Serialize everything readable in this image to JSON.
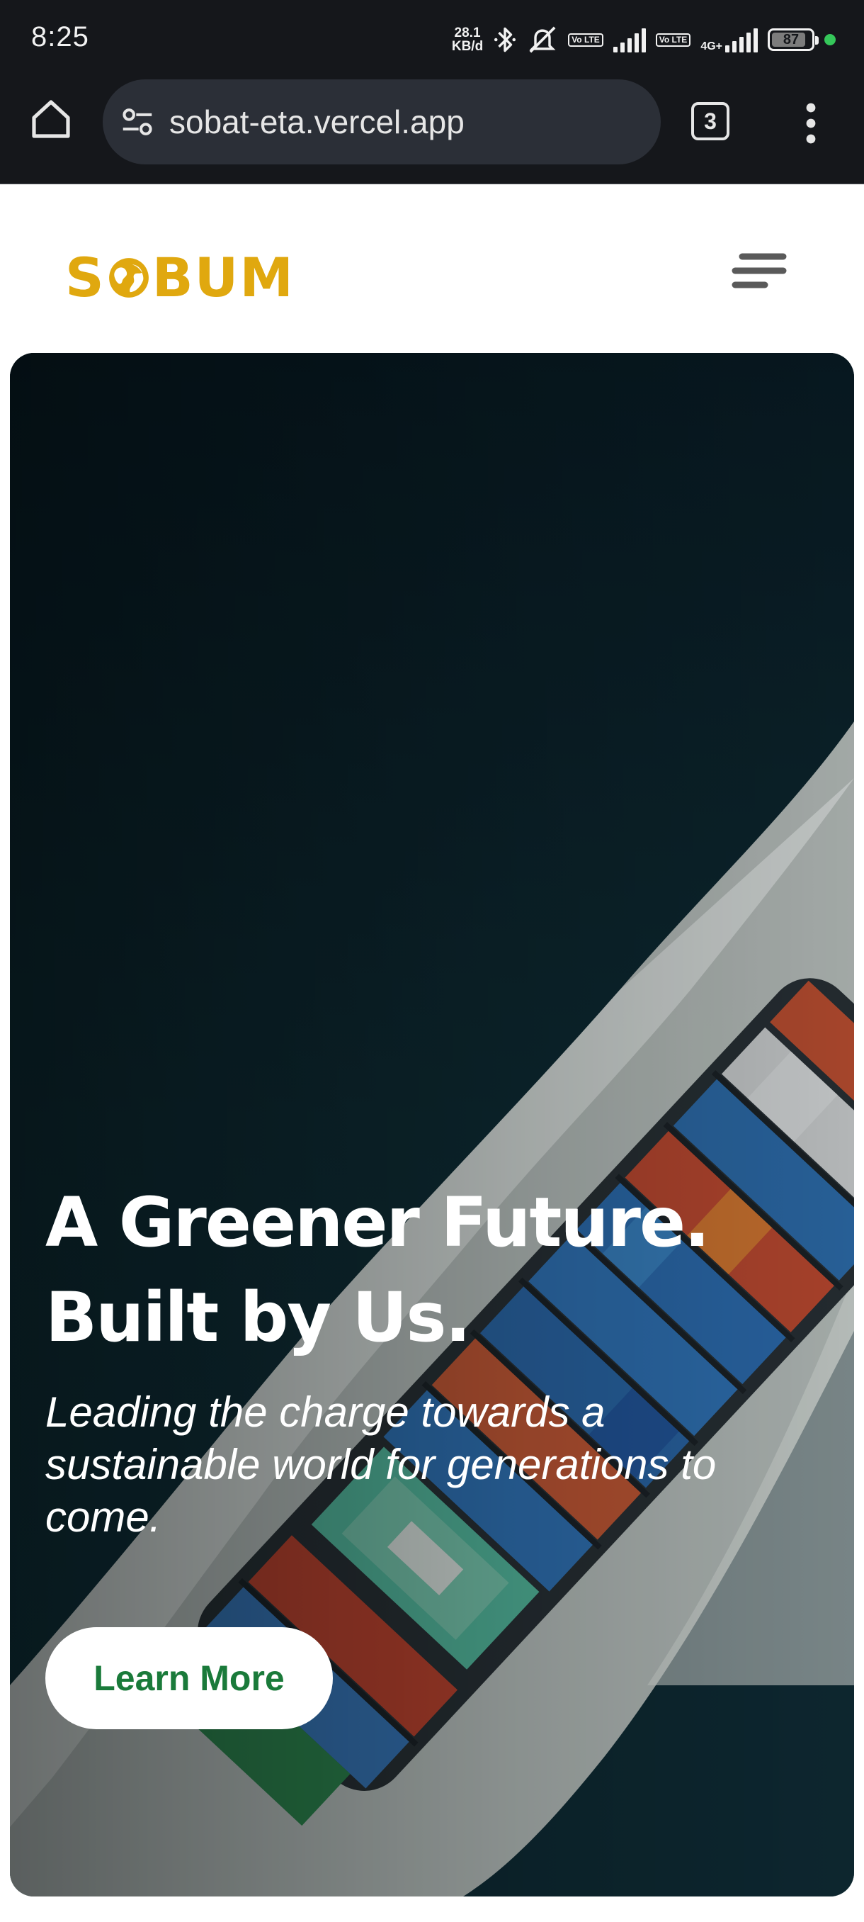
{
  "status_bar": {
    "time": "8:25",
    "net_speed_value": "28.1",
    "net_speed_unit": "KB/d",
    "battery_level": "87",
    "icons": [
      "bluetooth-icon",
      "mute-icon",
      "volte-icon",
      "signal-icon",
      "volte-icon",
      "4g-signal-icon",
      "battery-icon",
      "active-dot-icon"
    ],
    "volte_label": "Vo LTE",
    "network_label": "4G+"
  },
  "browser": {
    "url": "sobat-eta.vercel.app",
    "tab_count": "3",
    "icons": [
      "home-icon",
      "site-info-icon",
      "tabs-icon",
      "more-vert-icon"
    ]
  },
  "site": {
    "logo_left": "S",
    "logo_right": "BUM",
    "logo_color": "#e0a80f",
    "menu_icon": "hamburger-icon"
  },
  "hero": {
    "title_line1": "A Greener Future.",
    "title_line2": "Built by Us.",
    "subtitle": "Leading the charge towards a sustainable world for generations to come.",
    "cta_label": "Learn More",
    "cta_color": "#1a7a3a"
  }
}
